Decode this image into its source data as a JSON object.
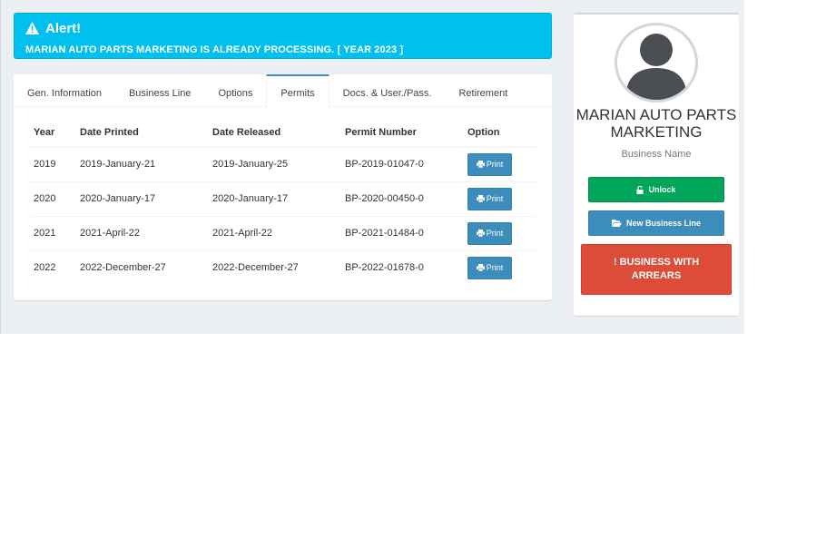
{
  "alert": {
    "title": "Alert!",
    "message": "MARIAN AUTO PARTS MARKETING IS ALREADY PROCESSING. [ YEAR 2023 ]",
    "icon": "warning-icon",
    "color": "#00c0ef"
  },
  "tabs": [
    {
      "label": "Gen. Information",
      "active": false
    },
    {
      "label": "Business Line",
      "active": false
    },
    {
      "label": "Options",
      "active": false
    },
    {
      "label": "Permits",
      "active": true
    },
    {
      "label": "Docs. & User./Pass.",
      "active": false
    },
    {
      "label": "Retirement",
      "active": false
    }
  ],
  "permits": {
    "columns": [
      "Year",
      "Date Printed",
      "Date Released",
      "Permit Number",
      "Option"
    ],
    "print_label": "Print",
    "rows": [
      {
        "year": "2019",
        "printed": "2019-January-21",
        "released": "2019-January-25",
        "number": "BP-2019-01047-0"
      },
      {
        "year": "2020",
        "printed": "2020-January-17",
        "released": "2020-January-17",
        "number": "BP-2020-00450-0"
      },
      {
        "year": "2021",
        "printed": "2021-April-22",
        "released": "2021-April-22",
        "number": "BP-2021-01484-0"
      },
      {
        "year": "2022",
        "printed": "2022-December-27",
        "released": "2022-December-27",
        "number": "BP-2022-01678-0"
      }
    ]
  },
  "profile": {
    "business_name": "MARIAN AUTO PARTS MARKETING",
    "business_name_label": "Business Name",
    "unlock_label": "Unlock",
    "new_business_line_label": "New Business Line",
    "arrears_label": "BUSINESS WITH ARREARS",
    "colors": {
      "unlock": "#00a65a",
      "new_line": "#3c8dbc",
      "arrears": "#dd4b39"
    }
  }
}
